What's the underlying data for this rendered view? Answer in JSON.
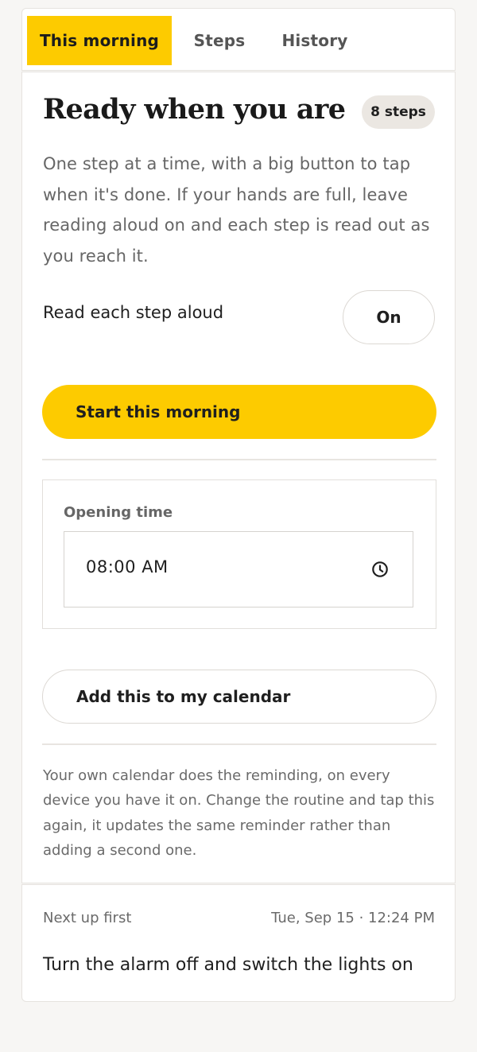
{
  "tabs": [
    {
      "label": "This morning",
      "active": true
    },
    {
      "label": "Steps",
      "active": false
    },
    {
      "label": "History",
      "active": false
    }
  ],
  "main": {
    "title": "Ready when you are",
    "badge": "8 steps",
    "intro": "One step at a time, with a big button to tap when it's done. If your hands are full, leave reading aloud on and each step is read out as you reach it.",
    "read_aloud": {
      "label": "Read each step aloud",
      "state": "On"
    },
    "start_button": "Start this morning",
    "opening_time": {
      "label": "Opening time",
      "value": "08:00 AM"
    },
    "calendar_button": "Add this to my calendar",
    "calendar_note": "Your own calendar does the reminding, on every device you have it on. Change the routine and tap this again, it updates the same reminder rather than adding a second one."
  },
  "next_up": {
    "label": "Next up first",
    "time": "Tue, Sep 15 · 12:24 PM",
    "step": "Turn the alarm off and switch the lights on"
  },
  "colors": {
    "accent": "#fdcb00",
    "background": "#f7f6f4",
    "badge": "#ebe7e2"
  },
  "icons": {
    "time_field": "clock-icon"
  }
}
